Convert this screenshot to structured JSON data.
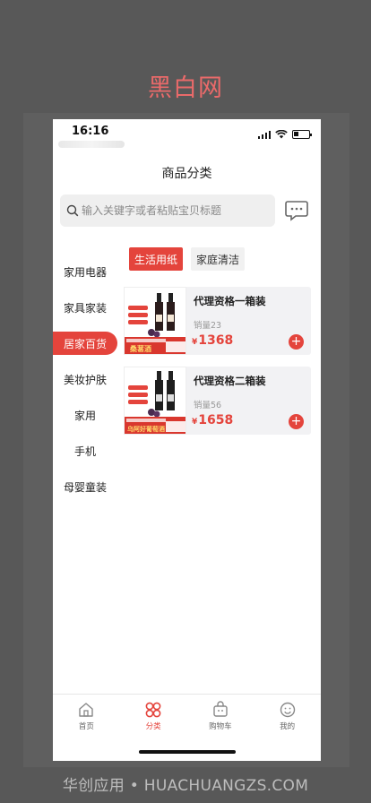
{
  "brand": "黑白网",
  "status": {
    "time": "16:16"
  },
  "page_title": "商品分类",
  "search": {
    "placeholder": "输入关键字或者粘贴宝贝标题"
  },
  "sidebar": {
    "items": [
      {
        "label": "家用电器",
        "active": false
      },
      {
        "label": "家具家装",
        "active": false
      },
      {
        "label": "居家百货",
        "active": true
      },
      {
        "label": "美妆护肤",
        "active": false
      },
      {
        "label": "家用",
        "active": false
      },
      {
        "label": "手机",
        "active": false
      },
      {
        "label": "母婴童装",
        "active": false
      }
    ]
  },
  "subtabs": [
    {
      "label": "生活用纸",
      "active": true
    },
    {
      "label": "家庭清洁",
      "active": false
    }
  ],
  "products": [
    {
      "name": "代理资格一箱装",
      "sales": "销量23",
      "currency": "¥",
      "price": "1368",
      "thumb_text": "桑葚酒"
    },
    {
      "name": "代理资格二箱装",
      "sales": "销量56",
      "currency": "¥",
      "price": "1658",
      "thumb_text": "乌阿好葡萄酒"
    }
  ],
  "tabbar": [
    {
      "label": "首页",
      "icon": "home-icon",
      "active": false
    },
    {
      "label": "分类",
      "icon": "category-icon",
      "active": true
    },
    {
      "label": "购物车",
      "icon": "cart-icon",
      "active": false
    },
    {
      "label": "我的",
      "icon": "profile-icon",
      "active": false
    }
  ],
  "footer": "华创应用 • HUACHUANGZS.COM",
  "colors": {
    "accent": "#e4443c",
    "brand": "#ea6a6a",
    "background": "#585858"
  }
}
